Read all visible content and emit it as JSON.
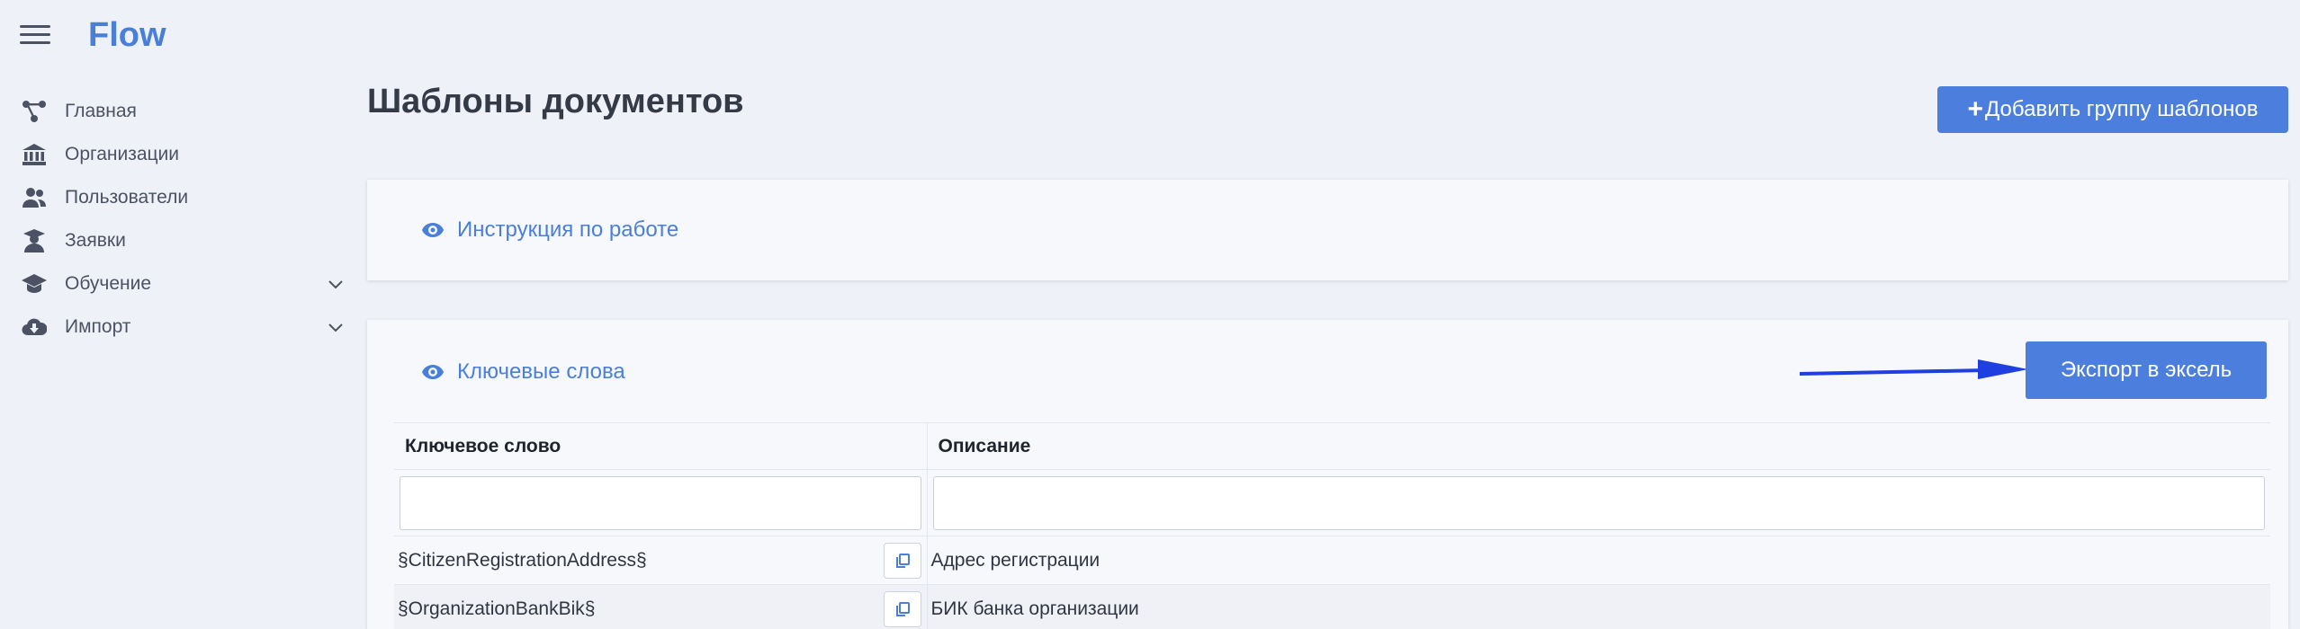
{
  "brand": "Flow",
  "sidebar": {
    "items": [
      {
        "label": "Главная",
        "icon": "network-icon"
      },
      {
        "label": "Организации",
        "icon": "bank-icon"
      },
      {
        "label": "Пользователи",
        "icon": "users-icon"
      },
      {
        "label": "Заявки",
        "icon": "user-graduate-icon"
      },
      {
        "label": "Обучение",
        "icon": "graduation-cap-icon",
        "expandable": true
      },
      {
        "label": "Импорт",
        "icon": "cloud-download-icon",
        "expandable": true
      }
    ]
  },
  "page": {
    "title": "Шаблоны документов",
    "add_group_label": "Добавить группу шаблонов"
  },
  "instructions_card": {
    "toggle_label": "Инструкция по работе"
  },
  "keywords_card": {
    "toggle_label": "Ключевые слова",
    "export_label": "Экспорт в эксель",
    "table": {
      "headers": [
        "Ключевое слово",
        "Описание"
      ],
      "rows": [
        {
          "keyword": "§CitizenRegistrationAddress§",
          "description": "Адрес регистрации"
        },
        {
          "keyword": "§OrganizationBankBik§",
          "description": "БИК банка организации"
        }
      ]
    }
  },
  "colors": {
    "accent": "#4c7fdd",
    "link": "#4a7fd9",
    "background": "#eef1f8",
    "annotation_arrow": "#1f3fe0"
  }
}
